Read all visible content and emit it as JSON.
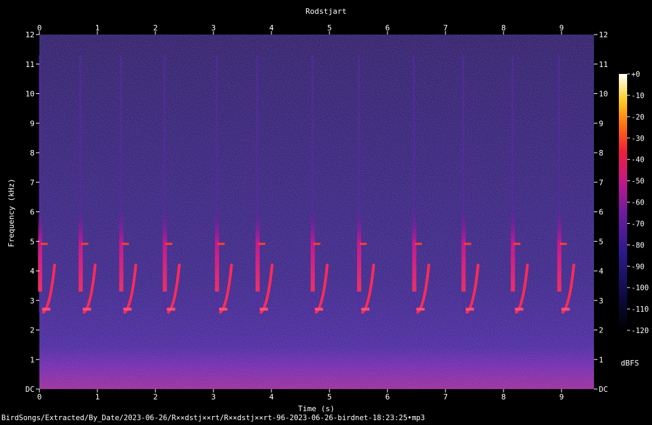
{
  "title": "Rodstjart",
  "footer_path": "BirdSongs/Extracted/By_Date/2023-06-26/R××dstj××rt/R××dstj××rt-96-2023-06-26-birdnet-18:23:25•mp3",
  "colorbar": {
    "unit_label": "dBFS",
    "ticks": [
      "+0",
      "-10",
      "-20",
      "-30",
      "-40",
      "-50",
      "-60",
      "-70",
      "-80",
      "-90",
      "-100",
      "-110",
      "-120"
    ]
  },
  "chart_data": {
    "type": "heatmap",
    "title": "Rodstjart",
    "xlabel": "Time (s)",
    "ylabel": "Frequency (kHz)",
    "xlim": [
      0,
      9.6
    ],
    "ylim": [
      0,
      12
    ],
    "x_ticks": [
      "0",
      "1",
      "2",
      "3",
      "4",
      "5",
      "6",
      "7",
      "8",
      "9"
    ],
    "y_ticks": [
      "DC",
      "1",
      "2",
      "3",
      "4",
      "5",
      "6",
      "7",
      "8",
      "9",
      "10",
      "11",
      "12"
    ],
    "color_range_dbfs": [
      -120,
      0
    ],
    "colormap": "black-purple-red-yellow-white",
    "song_phrase_onsets_s": [
      0.0,
      0.7,
      1.4,
      2.15,
      3.05,
      3.75,
      4.7,
      5.5,
      6.45,
      7.3,
      8.15,
      8.95
    ],
    "song_phrase_freq_range_khz": [
      2.6,
      6.0
    ],
    "background_noise_band_khz": [
      0,
      1.2
    ]
  }
}
